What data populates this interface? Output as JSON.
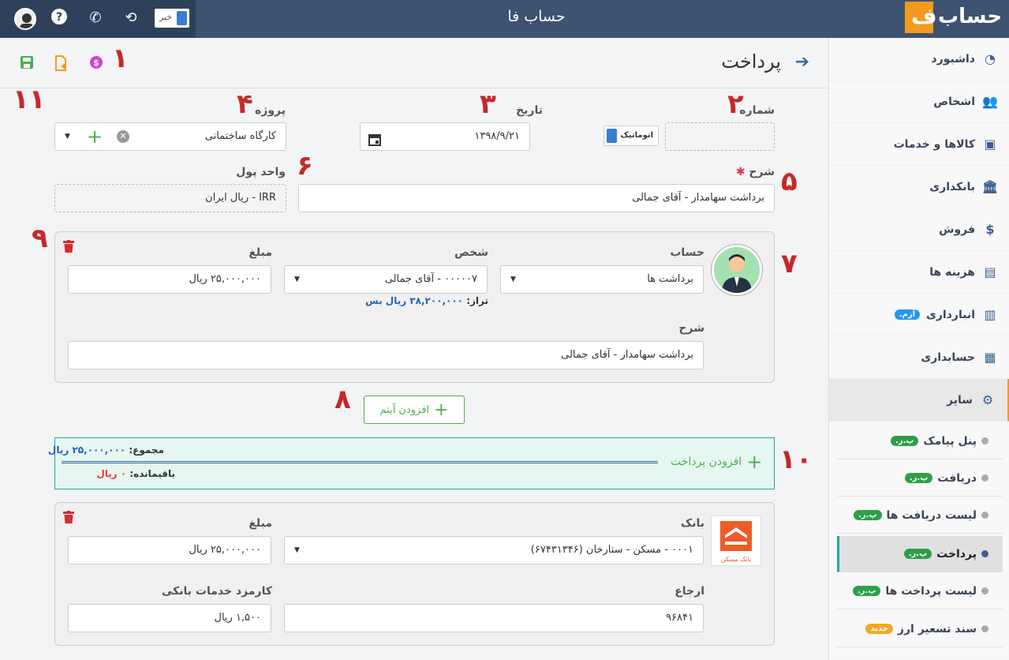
{
  "header": {
    "app_title": "حساب فا",
    "logo_text": "حساب",
    "toggle_label": "خیر"
  },
  "colors": {
    "topbar": "#3e5271",
    "accent_orange": "#f39a1f",
    "danger": "#c62828",
    "success": "#4caf50",
    "teal": "#26a69a"
  },
  "sidebar": {
    "items": [
      {
        "label": "داشبورد",
        "icon": "dashboard-icon"
      },
      {
        "label": "اشخاص",
        "icon": "people-icon"
      },
      {
        "label": "کالاها و خدمات",
        "icon": "box-icon"
      },
      {
        "label": "بانکداری",
        "icon": "bank-icon"
      },
      {
        "label": "فروش",
        "icon": "sales-icon"
      },
      {
        "label": "هزینه ها",
        "icon": "wallet-icon"
      },
      {
        "label": "انبارداری",
        "icon": "warehouse-icon",
        "badge": "آزم."
      },
      {
        "label": "حسابداری",
        "icon": "calculator-icon"
      },
      {
        "label": "سایر",
        "icon": "other-icon"
      }
    ],
    "subitems": [
      {
        "label": "پنل پیامک",
        "badge": "پ.ر."
      },
      {
        "label": "دریافت",
        "badge": "پ.ر."
      },
      {
        "label": "لیست دریافت ها",
        "badge": "پ.ر."
      },
      {
        "label": "پرداخت",
        "badge": "پ.ر."
      },
      {
        "label": "لیست پرداخت ها",
        "badge": "پ.ر."
      },
      {
        "label": "سند تسعیر ارز",
        "badge": "جدید"
      }
    ]
  },
  "page": {
    "title": "پرداخت",
    "number_label": "شماره",
    "auto_label": "اتوماتیک",
    "date_label": "تاریخ",
    "date_value": "۱۳۹۸/۹/۲۱",
    "project_label": "پروژه",
    "project_value": "کارگاه ساختمانی",
    "description_label": "شرح",
    "description_value": "برداشت سهامدار - آقای جمالی",
    "currency_label": "واحد پول",
    "currency_value": "IRR - ریال ایران"
  },
  "item1": {
    "account_label": "حساب",
    "account_value": "برداشت ها",
    "person_label": "شخص",
    "person_value": "۰۰۰۰۰۷ - آقای جمالی",
    "balance_prefix": "تراز:",
    "balance_value": "۳۸,۲۰۰,۰۰۰ ریال بس",
    "amount_label": "مبلغ",
    "amount_value": "۲۵,۰۰۰,۰۰۰ ریال",
    "desc_label": "شرح",
    "desc_value": "برداشت سهامدار - آقای جمالی"
  },
  "add_item_label": "افزودن آیتم",
  "summary": {
    "add_payment_label": "افزودن پرداخت",
    "total_label": "مجموع:",
    "total_value": "۲۵,۰۰۰,۰۰۰ ریال",
    "remaining_label": "باقیمانده:",
    "remaining_value": "۰ ریال"
  },
  "payment": {
    "bank_label": "بانک",
    "bank_value": "۰۰۰۱ - مسکن - ستارخان (۶۷۴۳۱۳۴۶)",
    "bank_logo_text": "بانک مسکن",
    "amount_label": "مبلغ",
    "amount_value": "۲۵,۰۰۰,۰۰۰ ریال",
    "ref_label": "ارجاع",
    "ref_value": "۹۶۸۴۱",
    "fee_label": "کارمزد خدمات بانکی",
    "fee_value": "۱,۵۰۰ ریال"
  },
  "annotations": [
    "۱",
    "۲",
    "۳",
    "۴",
    "۵",
    "۶",
    "۷",
    "۸",
    "۹",
    "۱۰",
    "۱۱"
  ]
}
